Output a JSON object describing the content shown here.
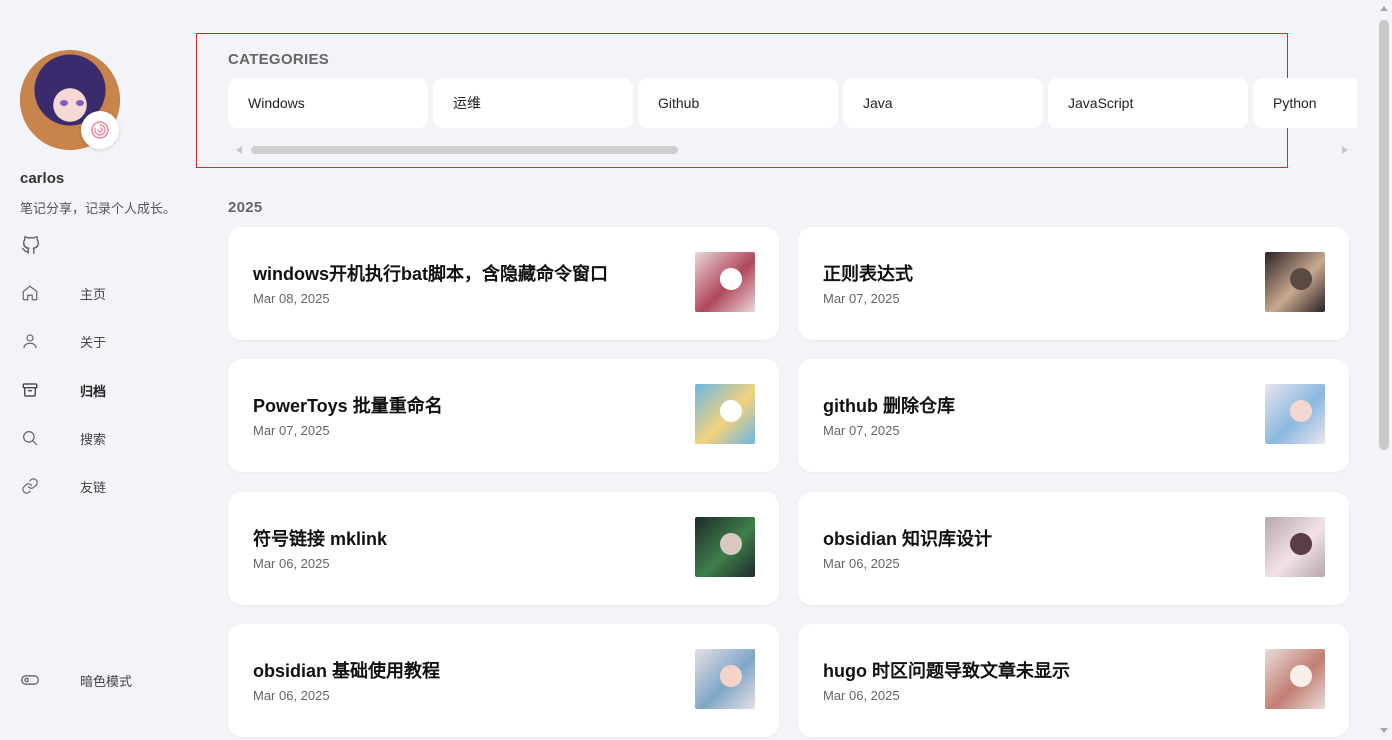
{
  "profile": {
    "name": "carlos",
    "description": "笔记分享，记录个人成长。",
    "github_icon": "github-icon",
    "badge_icon": "swirl-icon"
  },
  "nav": [
    {
      "label": "主页",
      "icon": "home-icon",
      "active": false
    },
    {
      "label": "关于",
      "icon": "user-icon",
      "active": false
    },
    {
      "label": "归档",
      "icon": "archive-icon",
      "active": true
    },
    {
      "label": "搜索",
      "icon": "search-icon",
      "active": false
    },
    {
      "label": "友链",
      "icon": "link-icon",
      "active": false
    }
  ],
  "dark_mode": {
    "label": "暗色模式",
    "icon": "toggle-icon"
  },
  "categories": {
    "title": "CATEGORIES",
    "items": [
      "Windows",
      "运维",
      "Github",
      "Java",
      "JavaScript",
      "Python"
    ]
  },
  "year": "2025",
  "posts": [
    {
      "title": "windows开机执行bat脚本，含隐藏命令窗口",
      "date": "Mar 08, 2025",
      "thumb_colors": [
        "#e8d7d9",
        "#b1475a",
        "#ffffff"
      ]
    },
    {
      "title": "正则表达式",
      "date": "Mar 07, 2025",
      "thumb_colors": [
        "#2a2225",
        "#c9a98f",
        "#5a4a44"
      ]
    },
    {
      "title": "PowerToys 批量重命名",
      "date": "Mar 07, 2025",
      "thumb_colors": [
        "#6bb6e6",
        "#f3d27a",
        "#ffffff"
      ]
    },
    {
      "title": "github 删除仓库",
      "date": "Mar 07, 2025",
      "thumb_colors": [
        "#e9e4ee",
        "#8ab8e0",
        "#f5d7d2"
      ]
    },
    {
      "title": "符号链接 mklink",
      "date": "Mar 06, 2025",
      "thumb_colors": [
        "#1f2a2b",
        "#3e7f4a",
        "#d9c8c2"
      ]
    },
    {
      "title": "obsidian 知识库设计",
      "date": "Mar 06, 2025",
      "thumb_colors": [
        "#b7a6ad",
        "#f2e3e6",
        "#5b3c47"
      ]
    },
    {
      "title": "obsidian 基础使用教程",
      "date": "Mar 06, 2025",
      "thumb_colors": [
        "#e6dfe5",
        "#7fa6c6",
        "#f4d3c9"
      ]
    },
    {
      "title": "hugo 时区问题导致文章未显示",
      "date": "Mar 06, 2025",
      "thumb_colors": [
        "#e9dcda",
        "#c27e72",
        "#f7efe9"
      ]
    }
  ]
}
